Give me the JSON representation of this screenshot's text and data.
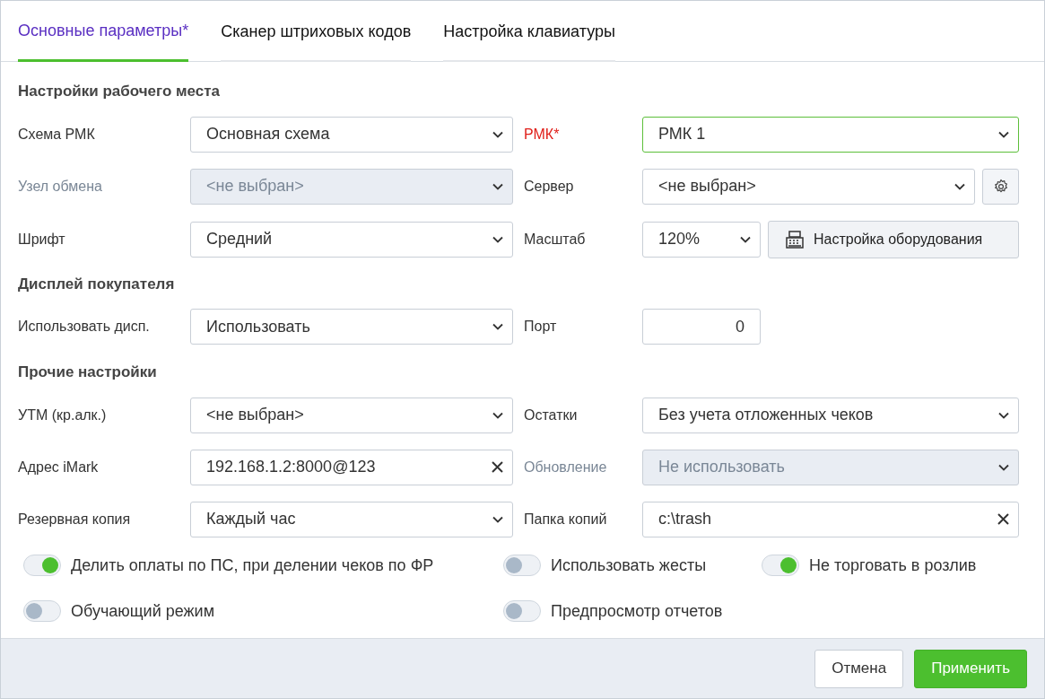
{
  "tabs": [
    {
      "label": "Основные параметры*",
      "selected": true
    },
    {
      "label": "Сканер штриховых кодов",
      "selected": false
    },
    {
      "label": "Настройка клавиатуры",
      "selected": false
    }
  ],
  "sections": [
    {
      "title": "Настройки рабочего места",
      "rows": [
        [
          {
            "label": "Схема РМК",
            "kind": "select",
            "value": "Основная схема",
            "required": false,
            "disabled": false
          },
          {
            "label": "РМК*",
            "kind": "select",
            "value": "РМК 1",
            "required": true,
            "disabled": false
          }
        ],
        [
          {
            "label": "Узел обмена",
            "kind": "select",
            "value": "<не выбран>",
            "required": false,
            "disabled": true
          },
          {
            "label": "Сервер",
            "kind": "select-settings",
            "value": "<не выбран>",
            "required": false,
            "disabled": false
          }
        ],
        [
          {
            "label": "Шрифт",
            "kind": "select",
            "value": "Средний",
            "required": false,
            "disabled": false
          },
          {
            "label": "Масштаб",
            "kind": "select-button",
            "value": "120%",
            "button": "Настройка оборудования",
            "required": false,
            "disabled": false
          }
        ]
      ]
    },
    {
      "title": "Дисплей покупателя",
      "rows": [
        [
          {
            "label": "Использовать дисп.",
            "kind": "select",
            "value": "Использовать",
            "required": false,
            "disabled": false
          },
          {
            "label": "Порт",
            "kind": "number",
            "value": "0",
            "required": false,
            "disabled": false
          }
        ]
      ]
    },
    {
      "title": "Прочие настройки",
      "rows": [
        [
          {
            "label": "УТМ (кр.алк.)",
            "kind": "select",
            "value": "<не выбран>",
            "required": false,
            "disabled": false
          },
          {
            "label": "Остатки",
            "kind": "select",
            "value": "Без учета отложенных чеков",
            "required": false,
            "disabled": false
          }
        ],
        [
          {
            "label": "Адрес iMark",
            "kind": "clearable",
            "value": "192.168.1.2:8000@123",
            "required": false,
            "disabled": false
          },
          {
            "label": "Обновление",
            "kind": "select",
            "value": "Не использовать",
            "required": false,
            "disabled": true
          }
        ],
        [
          {
            "label": "Резервная копия",
            "kind": "select",
            "value": "Каждый час",
            "required": false,
            "disabled": false
          },
          {
            "label": "Папка копий",
            "kind": "clearable",
            "value": "c:\\trash",
            "required": false,
            "disabled": false
          }
        ]
      ]
    }
  ],
  "toggles": [
    [
      {
        "label": "Делить оплаты по ПС, при делении чеков по ФР",
        "on": true
      },
      {
        "label": "Использовать жесты",
        "on": false
      },
      {
        "label": "Не торговать в розлив",
        "on": true
      }
    ],
    [
      {
        "label": "Обучающий режим",
        "on": false
      },
      {
        "label": "Предпросмотр отчетов",
        "on": false
      }
    ]
  ],
  "buttons": [
    {
      "label": "Отмена",
      "kind": "secondary"
    },
    {
      "label": "Применить",
      "kind": "primary"
    }
  ]
}
